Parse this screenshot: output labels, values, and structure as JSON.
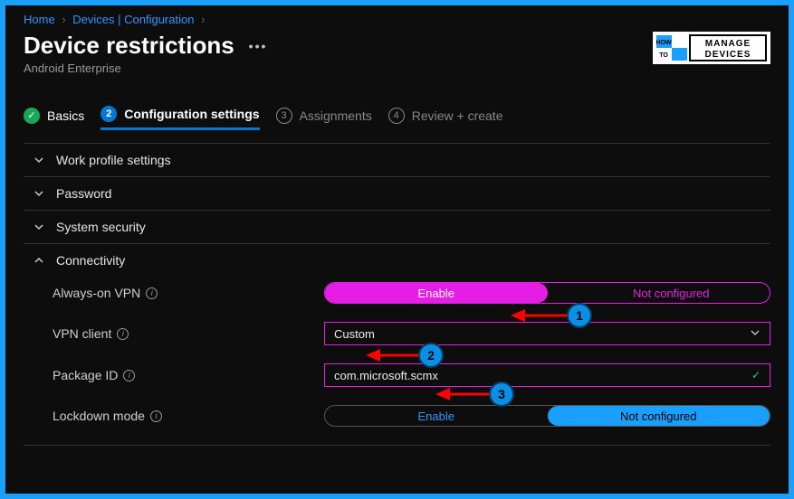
{
  "breadcrumb": {
    "home": "Home",
    "devices": "Devices | Configuration"
  },
  "header": {
    "title": "Device restrictions",
    "subtitle": "Android Enterprise"
  },
  "logo": {
    "how": "HOW",
    "to": "TO",
    "manage": "MANAGE",
    "devices": "DEVICES"
  },
  "steps": {
    "s1": "Basics",
    "s2": "Configuration settings",
    "s3": "Assignments",
    "s4": "Review + create",
    "n2": "2",
    "n3": "3",
    "n4": "4"
  },
  "sections": {
    "workprofile": "Work profile settings",
    "password": "Password",
    "systemsecurity": "System security",
    "connectivity": "Connectivity"
  },
  "fields": {
    "alwaysvpn": {
      "label": "Always-on VPN",
      "opt1": "Enable",
      "opt2": "Not configured"
    },
    "vpnclient": {
      "label": "VPN client",
      "value": "Custom"
    },
    "packageid": {
      "label": "Package ID",
      "value": "com.microsoft.scmx"
    },
    "lockdown": {
      "label": "Lockdown mode",
      "opt1": "Enable",
      "opt2": "Not configured"
    }
  },
  "annotations": {
    "n1": "1",
    "n2": "2",
    "n3": "3"
  }
}
